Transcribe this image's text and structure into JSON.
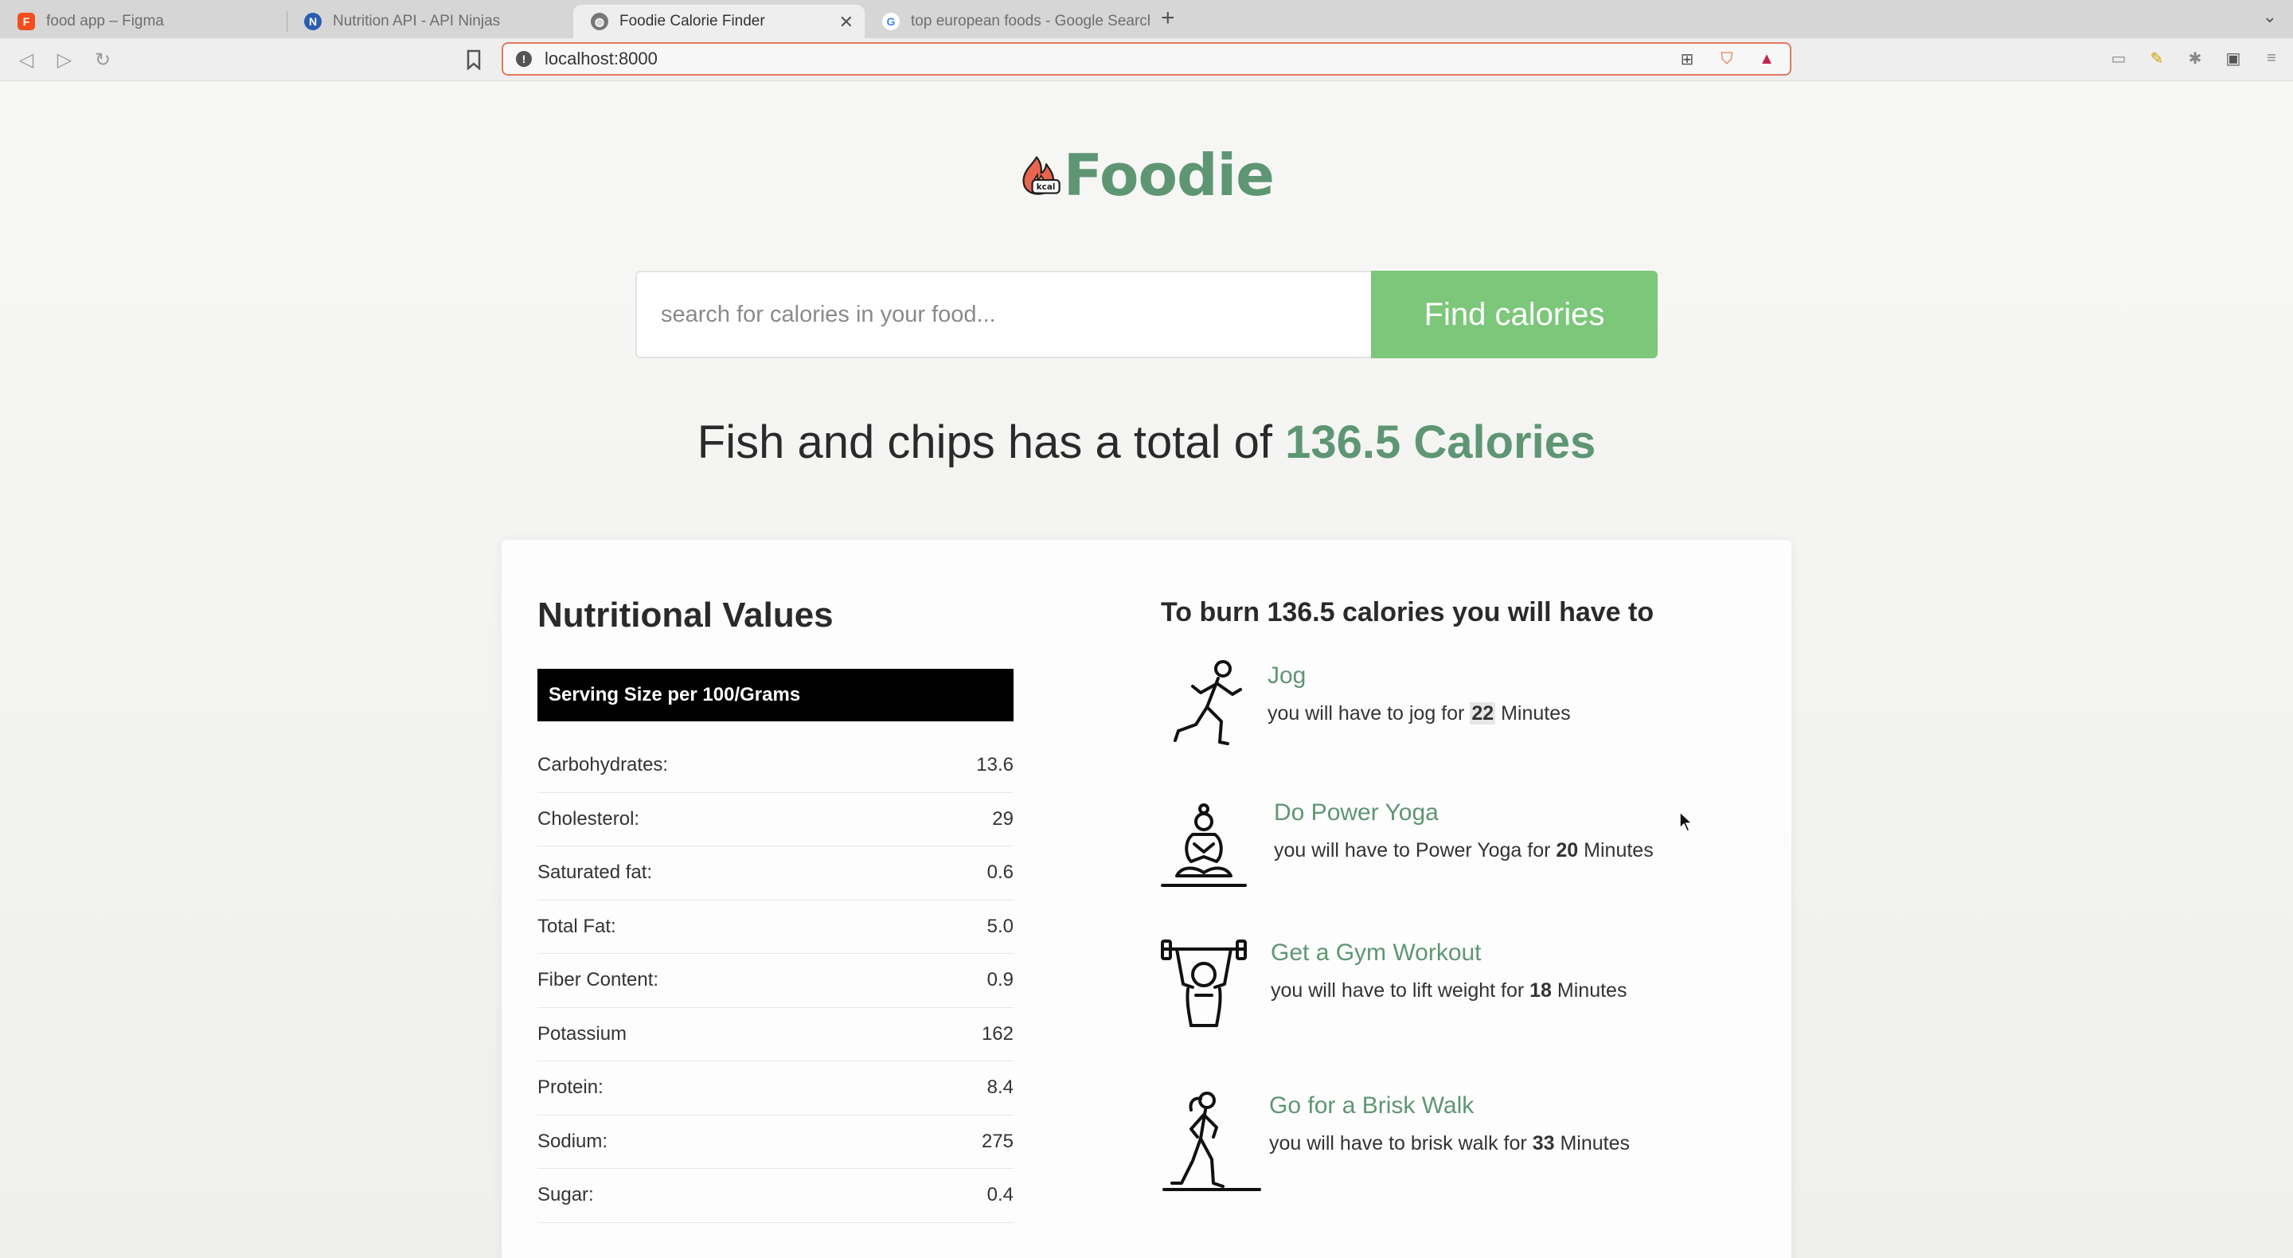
{
  "browser": {
    "tabs": [
      {
        "title": "food app – Figma",
        "active": false
      },
      {
        "title": "Nutrition API - API Ninjas",
        "active": false
      },
      {
        "title": "Foodie Calorie Finder",
        "active": true
      },
      {
        "title": "top european foods - Google Search",
        "active": false
      }
    ],
    "url": "localhost:8000"
  },
  "app": {
    "logo_badge": "kcal",
    "logo_word": "Foodie"
  },
  "search": {
    "placeholder": "search for calories in your food...",
    "button_label": "Find calories"
  },
  "result": {
    "text": "Fish and chips has a total of",
    "calories": "136.5 Calories"
  },
  "nutrition": {
    "title": "Nutritional Values",
    "serving": "Serving Size per 100/Grams",
    "rows": [
      {
        "label": "Carbohydrates:",
        "value": "13.6"
      },
      {
        "label": "Cholesterol:",
        "value": "29"
      },
      {
        "label": "Saturated fat:",
        "value": "0.6"
      },
      {
        "label": "Total Fat:",
        "value": "5.0"
      },
      {
        "label": "Fiber Content:",
        "value": "0.9"
      },
      {
        "label": "Potassium",
        "value": "162"
      },
      {
        "label": "Protein:",
        "value": "8.4"
      },
      {
        "label": "Sodium:",
        "value": "275"
      },
      {
        "label": "Sugar:",
        "value": "0.4"
      }
    ]
  },
  "burn": {
    "title": "To burn 136.5 calories you will have to",
    "activities": [
      {
        "name": "Jog",
        "prefix": "you will have to jog for",
        "minutes": "22",
        "suffix": "Minutes",
        "icon": "jogger-icon"
      },
      {
        "name": "Do Power Yoga",
        "prefix": "you will have to Power Yoga for",
        "minutes": "20",
        "suffix": "Minutes",
        "icon": "yoga-icon"
      },
      {
        "name": "Get a Gym Workout",
        "prefix": "you will have to lift weight for",
        "minutes": "18",
        "suffix": "Minutes",
        "icon": "weightlifting-icon"
      },
      {
        "name": "Go for a Brisk Walk",
        "prefix": "you will have to brisk walk for",
        "minutes": "33",
        "suffix": "Minutes",
        "icon": "walking-icon"
      }
    ]
  },
  "colors": {
    "brand_green": "#5e9673",
    "button_green": "#7cc77a",
    "serving_bg": "#000000",
    "flame": "#e8654f"
  }
}
